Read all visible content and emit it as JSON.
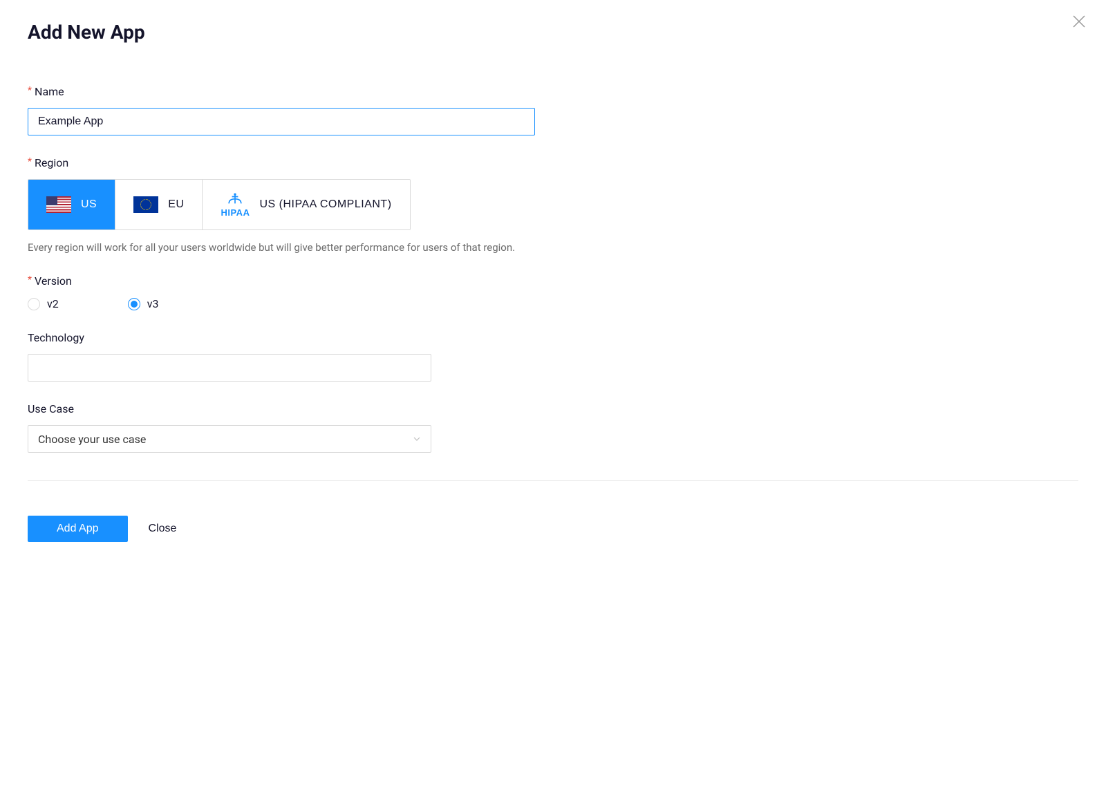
{
  "dialog": {
    "title": "Add New App"
  },
  "form": {
    "name": {
      "label": "Name",
      "value": "Example App",
      "required": true
    },
    "region": {
      "label": "Region",
      "required": true,
      "help_text": "Every region will work for all your users worldwide but will give better performance for users of that region.",
      "options": [
        {
          "label": "US",
          "selected": true,
          "icon": "us-flag-icon"
        },
        {
          "label": "EU",
          "selected": false,
          "icon": "eu-flag-icon"
        },
        {
          "label": "US (HIPAA COMPLIANT)",
          "selected": false,
          "icon": "hipaa-icon",
          "badge_text": "HIPAA"
        }
      ]
    },
    "version": {
      "label": "Version",
      "required": true,
      "options": [
        {
          "label": "v2",
          "checked": false
        },
        {
          "label": "v3",
          "checked": true
        }
      ]
    },
    "technology": {
      "label": "Technology",
      "value": ""
    },
    "use_case": {
      "label": "Use Case",
      "placeholder": "Choose your use case"
    }
  },
  "buttons": {
    "submit": "Add App",
    "cancel": "Close"
  }
}
